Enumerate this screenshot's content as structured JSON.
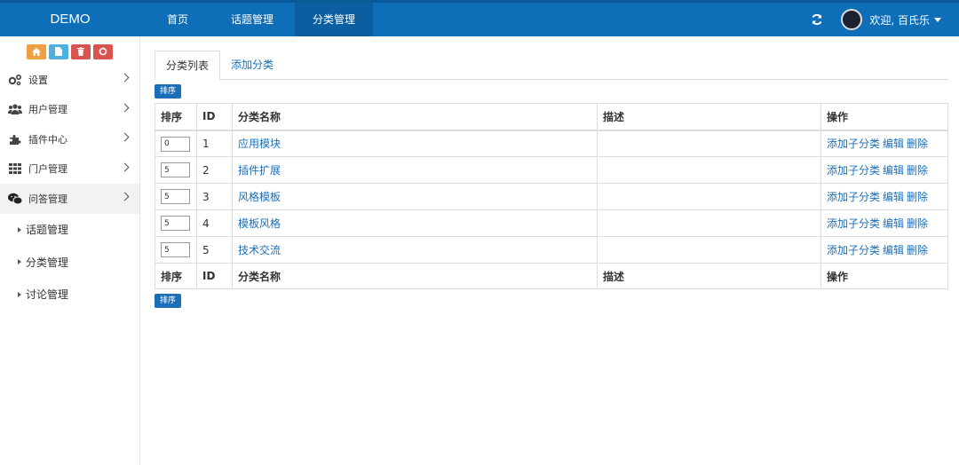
{
  "brand": "DEMO",
  "nav": {
    "items": [
      {
        "label": "首页",
        "active": false
      },
      {
        "label": "话题管理",
        "active": false
      },
      {
        "label": "分类管理",
        "active": true
      }
    ]
  },
  "user": {
    "welcome": "欢迎, 百氏乐"
  },
  "sidebar": {
    "shortcuts": [
      {
        "icon": "home-icon",
        "color": "#f0a041"
      },
      {
        "icon": "file-icon",
        "color": "#4fb0e0"
      },
      {
        "icon": "trash-icon",
        "color": "#d9534f"
      },
      {
        "icon": "recycle-icon",
        "color": "#d9534f"
      }
    ],
    "menu": [
      {
        "label": "设置",
        "icon": "gears-icon"
      },
      {
        "label": "用户管理",
        "icon": "users-icon"
      },
      {
        "label": "插件中心",
        "icon": "puzzle-icon"
      },
      {
        "label": "门户管理",
        "icon": "grid-icon"
      },
      {
        "label": "问答管理",
        "icon": "wechat-icon",
        "active": true
      }
    ],
    "submenu": [
      {
        "label": "话题管理"
      },
      {
        "label": "分类管理"
      },
      {
        "label": "讨论管理"
      }
    ]
  },
  "main": {
    "tabs": [
      {
        "label": "分类列表",
        "active": true
      },
      {
        "label": "添加分类",
        "active": false
      }
    ],
    "sort_button": "排序",
    "columns": [
      "排序",
      "ID",
      "分类名称",
      "描述",
      "操作"
    ],
    "rows": [
      {
        "sort": "0",
        "id": "1",
        "name": "应用模块",
        "desc": ""
      },
      {
        "sort": "5",
        "id": "2",
        "name": "插件扩展",
        "desc": ""
      },
      {
        "sort": "5",
        "id": "3",
        "name": "风格模板",
        "desc": ""
      },
      {
        "sort": "5",
        "id": "4",
        "name": "模板风格",
        "desc": ""
      },
      {
        "sort": "5",
        "id": "5",
        "name": "技术交流",
        "desc": ""
      }
    ],
    "actions": {
      "add_child": "添加子分类",
      "edit": "编辑",
      "delete": "删除"
    }
  },
  "colors": {
    "topbar": "#0e6eb8",
    "link": "#1b6fb8"
  }
}
